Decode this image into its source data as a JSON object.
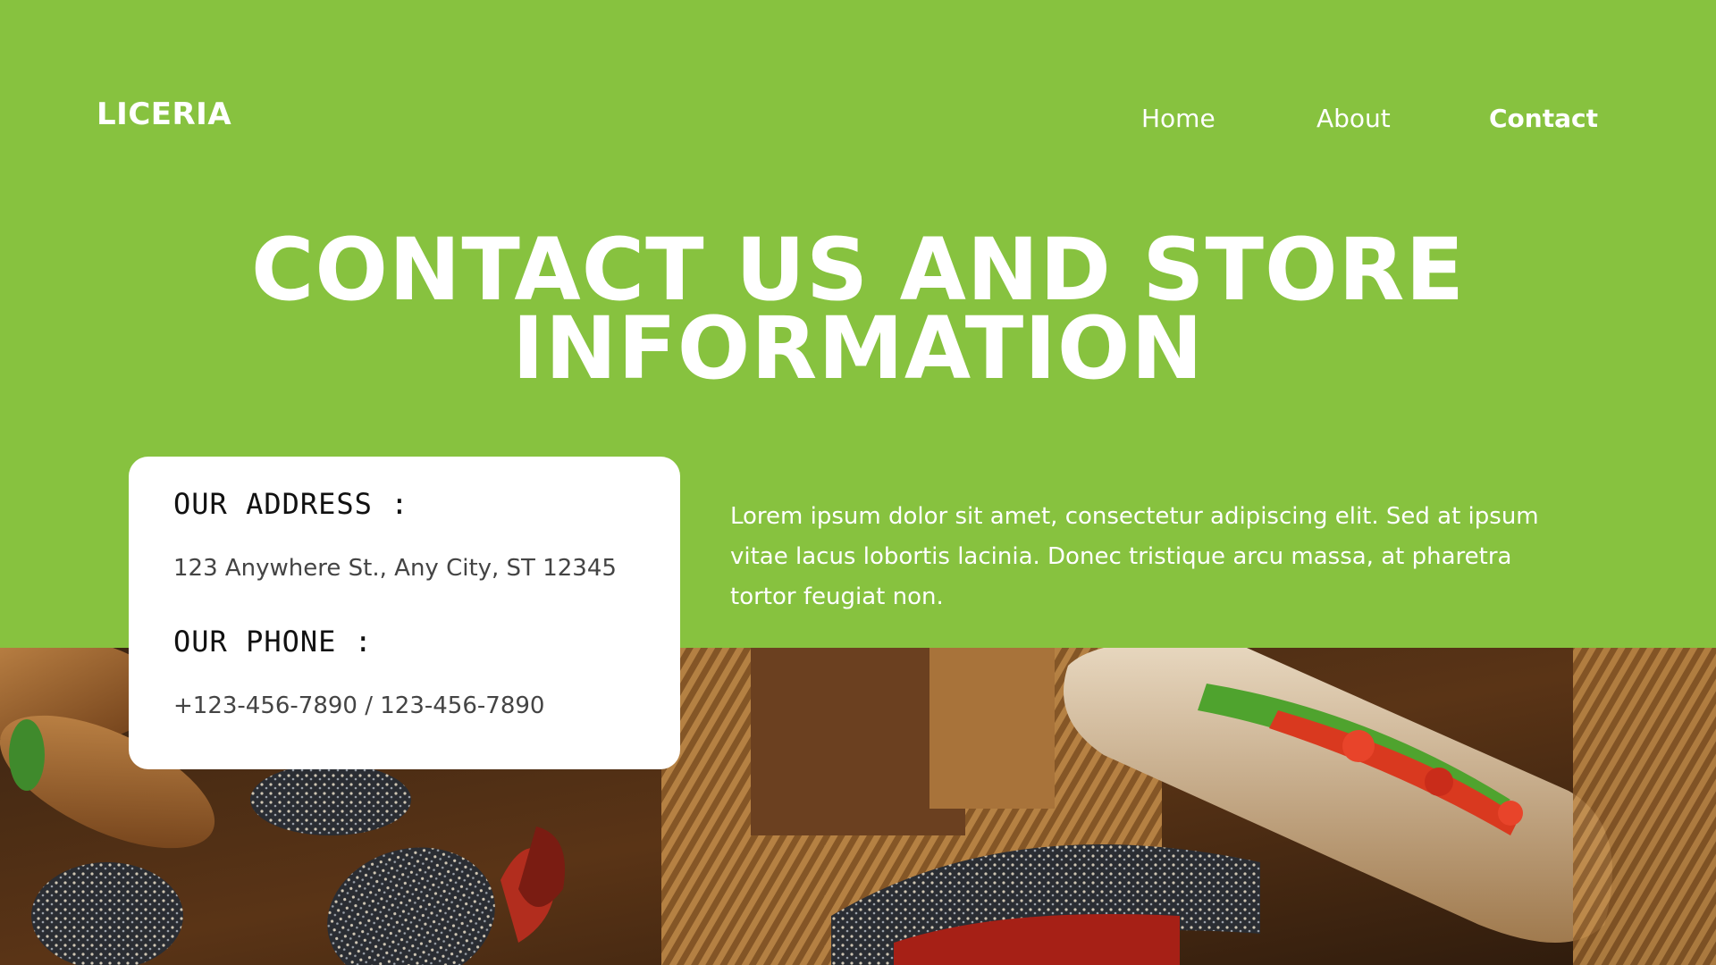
{
  "brand": "LICERIA",
  "nav": [
    {
      "label": "Home",
      "active": false
    },
    {
      "label": "About",
      "active": false
    },
    {
      "label": "Contact",
      "active": true
    }
  ],
  "hero": {
    "line1": "CONTACT US AND STORE",
    "line2": "INFORMATION"
  },
  "intro": "Lorem ipsum dolor sit amet, consectetur adipiscing elit. Sed at ipsum vitae lacus lobortis lacinia. Donec tristique arcu massa, at pharetra tortor feugiat non.",
  "contact_card": {
    "address_label": "OUR ADDRESS :",
    "address": "123 Anywhere St., Any City, ST 12345",
    "phone_label": "OUR PHONE :",
    "phone": "+123-456-7890 / 123-456-7890"
  },
  "colors": {
    "brand_green": "#87c23f",
    "card_bg": "#ffffff",
    "text_light": "#ffffff"
  },
  "photo": {
    "icon": "food-basket-photo"
  }
}
